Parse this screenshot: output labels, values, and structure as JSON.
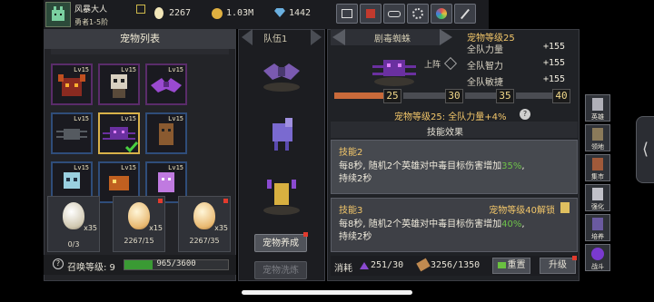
{
  "player": {
    "name": "风暴大人",
    "rank": "勇者1-5阶"
  },
  "resources": {
    "eggs": "2267",
    "gold": "1.03M",
    "gems": "1442"
  },
  "pet_list": {
    "title": "宠物列表",
    "slots": [
      {
        "lv": "Lv15",
        "tier": "epic"
      },
      {
        "lv": "Lv15",
        "tier": "epic"
      },
      {
        "lv": "Lv15",
        "tier": "epic"
      },
      {
        "lv": "Lv15",
        "tier": "rare"
      },
      {
        "lv": "Lv15",
        "tier": "rare",
        "selected": true
      },
      {
        "lv": "Lv15",
        "tier": "rare"
      },
      {
        "lv": "Lv15",
        "tier": "rare"
      },
      {
        "lv": "Lv15",
        "tier": "rare"
      },
      {
        "lv": "Lv15",
        "tier": "rare"
      }
    ]
  },
  "eggs": [
    {
      "count": "x35",
      "cost": "0/3"
    },
    {
      "count": "x15",
      "cost": "2267/15"
    },
    {
      "count": "x35",
      "cost": "2267/35"
    }
  ],
  "summon": {
    "label": "召唤等级: 9",
    "progress": "965/3600",
    "ratio": 0.268
  },
  "team": {
    "title": "队伍1",
    "train_btn": "宠物养成",
    "wash_btn": "宠物洗炼"
  },
  "detail": {
    "pet_name": "剧毒蜘蛛",
    "deploy_label": "上阵",
    "level_title": "宠物等级25",
    "stats": [
      {
        "label": "全队力量",
        "value": "+155"
      },
      {
        "label": "全队智力",
        "value": "+155"
      },
      {
        "label": "全队敏捷",
        "value": "+155"
      }
    ],
    "milestones": [
      "25",
      "30",
      "35",
      "40"
    ],
    "bonus": "宠物等级25: 全队力量+4%",
    "skill_header": "技能效果",
    "skill2": {
      "title": "技能2",
      "pre": "每8秒, 随机2个英雄对中毒目标伤害增加",
      "pct": "35%",
      "post": ",",
      "line2": "持续2秒"
    },
    "skill3": {
      "title": "技能3",
      "unlock": "宠物等级40解锁",
      "pre": "每8秒, 随机2个英雄对中毒目标伤害增加",
      "pct": "40%",
      "post": ",",
      "line2": "持续2秒"
    },
    "cost_label": "消耗",
    "cost1": "251/30",
    "cost2": "3256/1350",
    "reset_btn": "重置",
    "upgrade_btn": "升级"
  },
  "side_menu": [
    {
      "label": "英雄"
    },
    {
      "label": "领地"
    },
    {
      "label": "集市"
    },
    {
      "label": "强化"
    },
    {
      "label": "培养"
    },
    {
      "label": "战斗"
    }
  ],
  "colors": {
    "accent": "#f3c76a",
    "green": "#6ec24a",
    "bar_orange": "#c96a3a",
    "progress_green": "#3a9a34"
  }
}
